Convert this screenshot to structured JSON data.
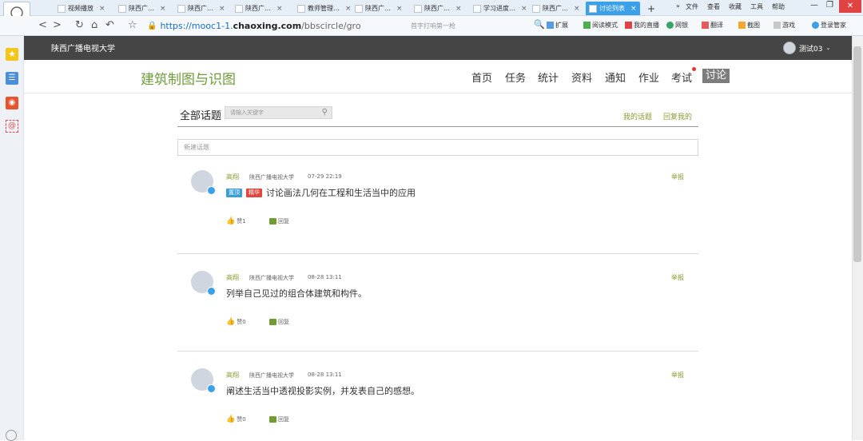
{
  "browser": {
    "tabs": [
      {
        "label": "视频播放",
        "active": false
      },
      {
        "label": "陕西广…",
        "active": false
      },
      {
        "label": "陕西广…",
        "active": false
      },
      {
        "label": "陕西广…",
        "active": false
      },
      {
        "label": "教师管理…",
        "active": false
      },
      {
        "label": "陕西广…",
        "active": false
      },
      {
        "label": "陕西广…",
        "active": false
      },
      {
        "label": "学习进度…",
        "active": false
      },
      {
        "label": "陕西广…",
        "active": false
      },
      {
        "label": "讨论列表",
        "active": true
      }
    ],
    "new_tab": "+",
    "menu": [
      "文件",
      "查看",
      "收藏",
      "工具",
      "帮助"
    ],
    "url_prefix": "https://mooc1-1.",
    "url_domain": "chaoxing.com",
    "url_path": "/bbscircle/gro",
    "search_placeholder": "首字打响第一枪",
    "toolbar": [
      "扩展",
      "阅读模式",
      "我的直播",
      "网银",
      "翻译",
      "截图",
      "游戏",
      "登录管家"
    ]
  },
  "site": {
    "name": "陕西广播电视大学",
    "user": "测试03"
  },
  "course": {
    "title": "建筑制图与识图",
    "nav": [
      {
        "label": "首页",
        "active": false
      },
      {
        "label": "任务",
        "active": false
      },
      {
        "label": "统计",
        "active": false
      },
      {
        "label": "资料",
        "active": false
      },
      {
        "label": "通知",
        "active": false
      },
      {
        "label": "作业",
        "active": false
      },
      {
        "label": "考试",
        "active": false
      },
      {
        "label": "讨论",
        "active": true
      }
    ]
  },
  "discussion": {
    "heading": "全部话题",
    "search_placeholder": "请输入关键字",
    "my_topics": "我的话题",
    "reply_to_me": "回复我的",
    "new_topic_placeholder": "新建话题",
    "report_label": "举报",
    "reply_label": "回复",
    "posts": [
      {
        "author": "高翔",
        "school": "陕西广播电视大学",
        "time": "07-29 22:19",
        "badges": [
          "置顶",
          "精华"
        ],
        "content": "讨论画法几何在工程和生活当中的应用",
        "likes": "赞1"
      },
      {
        "author": "高翔",
        "school": "陕西广播电视大学",
        "time": "08-28 13:11",
        "badges": [],
        "content": "列举自己见过的组合体建筑和构件。",
        "likes": "赞0"
      },
      {
        "author": "高翔",
        "school": "陕西广播电视大学",
        "time": "08-28 13:11",
        "badges": [],
        "content": "阐述生活当中透视投影实例，并发表自己的感想。",
        "likes": "赞0"
      }
    ]
  },
  "colors": {
    "accent_green": "#6e9b3b",
    "link_olive": "#8c9a36",
    "header_dark": "#454545",
    "tab_active": "#3ba0e8",
    "badge_top": "#3a9fd8",
    "badge_hot": "#e0483e"
  }
}
